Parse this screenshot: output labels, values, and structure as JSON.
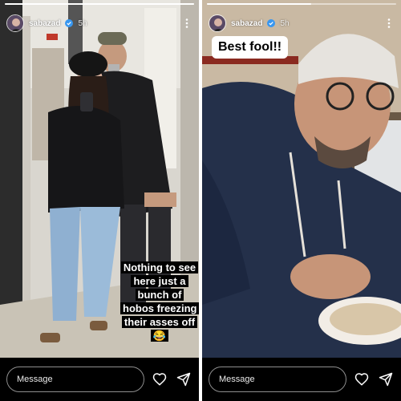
{
  "stories": [
    {
      "username": "sabazad",
      "time": "5h",
      "caption": "Nothing to see here just a bunch of hobos freezing their asses off 😂",
      "progress": 1.0,
      "message_placeholder": "Message"
    },
    {
      "username": "sabazad",
      "time": "5h",
      "caption": "Best fool!!",
      "progress": 0.55,
      "message_placeholder": "Message"
    }
  ],
  "icons": {
    "verified": "verified-badge-icon",
    "more": "more-options-icon",
    "like": "heart-icon",
    "share": "send-icon"
  },
  "colors": {
    "verified": "#3897f0",
    "background": "#000000"
  }
}
